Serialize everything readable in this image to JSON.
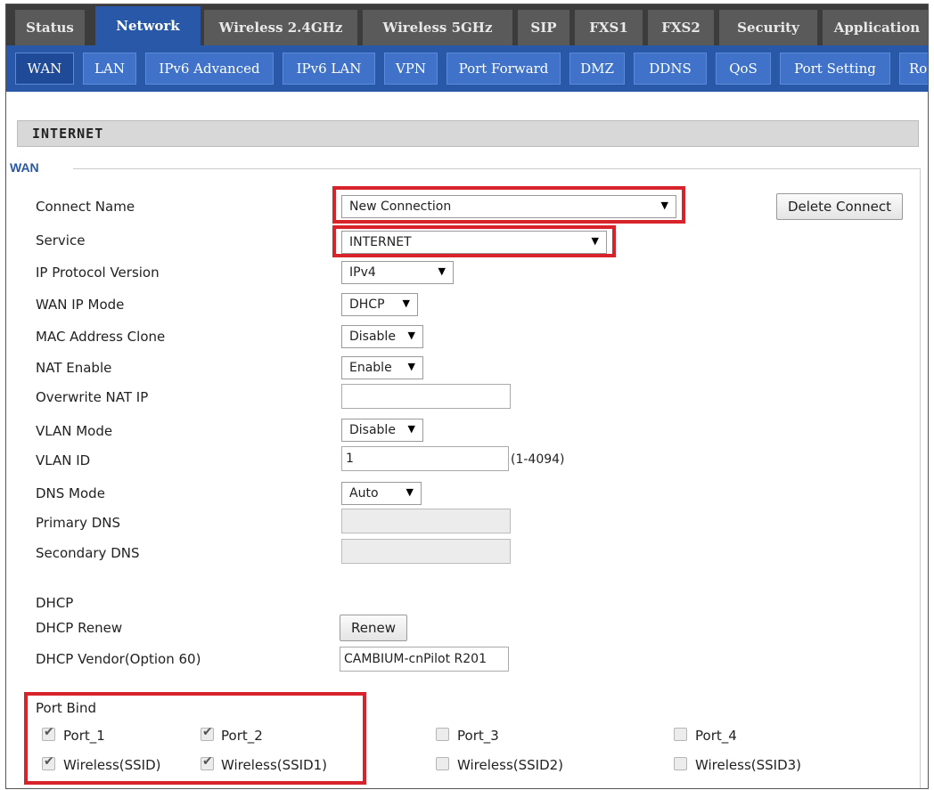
{
  "top_tabs": [
    "Status",
    "Network",
    "Wireless 2.4GHz",
    "Wireless 5GHz",
    "SIP",
    "FXS1",
    "FXS2",
    "Security",
    "Application"
  ],
  "active_top_tab": "Network",
  "sub_tabs": [
    "WAN",
    "LAN",
    "IPv6 Advanced",
    "IPv6 LAN",
    "VPN",
    "Port Forward",
    "DMZ",
    "DDNS",
    "QoS",
    "Port Setting",
    "Rou"
  ],
  "active_sub_tab": "WAN",
  "section_title": "INTERNET",
  "legend": "WAN",
  "form": {
    "connect_name": {
      "label": "Connect Name",
      "value": "New Connection"
    },
    "delete_button": "Delete Connect",
    "service": {
      "label": "Service",
      "value": "INTERNET"
    },
    "ip_protocol": {
      "label": "IP Protocol Version",
      "value": "IPv4"
    },
    "wan_ip_mode": {
      "label": "WAN IP Mode",
      "value": "DHCP"
    },
    "mac_clone": {
      "label": "MAC Address Clone",
      "value": "Disable"
    },
    "nat_enable": {
      "label": "NAT Enable",
      "value": "Enable"
    },
    "overwrite_nat_ip": {
      "label": "Overwrite NAT IP",
      "value": ""
    },
    "vlan_mode": {
      "label": "VLAN Mode",
      "value": "Disable"
    },
    "vlan_id": {
      "label": "VLAN ID",
      "value": "1",
      "hint": "(1-4094)"
    },
    "dns_mode": {
      "label": "DNS Mode",
      "value": "Auto"
    },
    "primary_dns": {
      "label": "Primary DNS",
      "value": ""
    },
    "secondary_dns": {
      "label": "Secondary DNS",
      "value": ""
    },
    "dhcp_heading": "DHCP",
    "dhcp_renew": {
      "label": "DHCP Renew",
      "button": "Renew"
    },
    "dhcp_vendor": {
      "label": "DHCP Vendor(Option 60)",
      "value": "CAMBIUM-cnPilot R201"
    }
  },
  "port_bind": {
    "label": "Port Bind",
    "items": [
      {
        "label": "Port_1",
        "checked": true
      },
      {
        "label": "Port_2",
        "checked": true
      },
      {
        "label": "Port_3",
        "checked": false
      },
      {
        "label": "Port_4",
        "checked": false
      },
      {
        "label": "Wireless(SSID)",
        "checked": true
      },
      {
        "label": "Wireless(SSID1)",
        "checked": true
      },
      {
        "label": "Wireless(SSID2)",
        "checked": false
      },
      {
        "label": "Wireless(SSID3)",
        "checked": false
      }
    ]
  },
  "highlight_color": "#d8232a",
  "accent_color": "#2958a8"
}
